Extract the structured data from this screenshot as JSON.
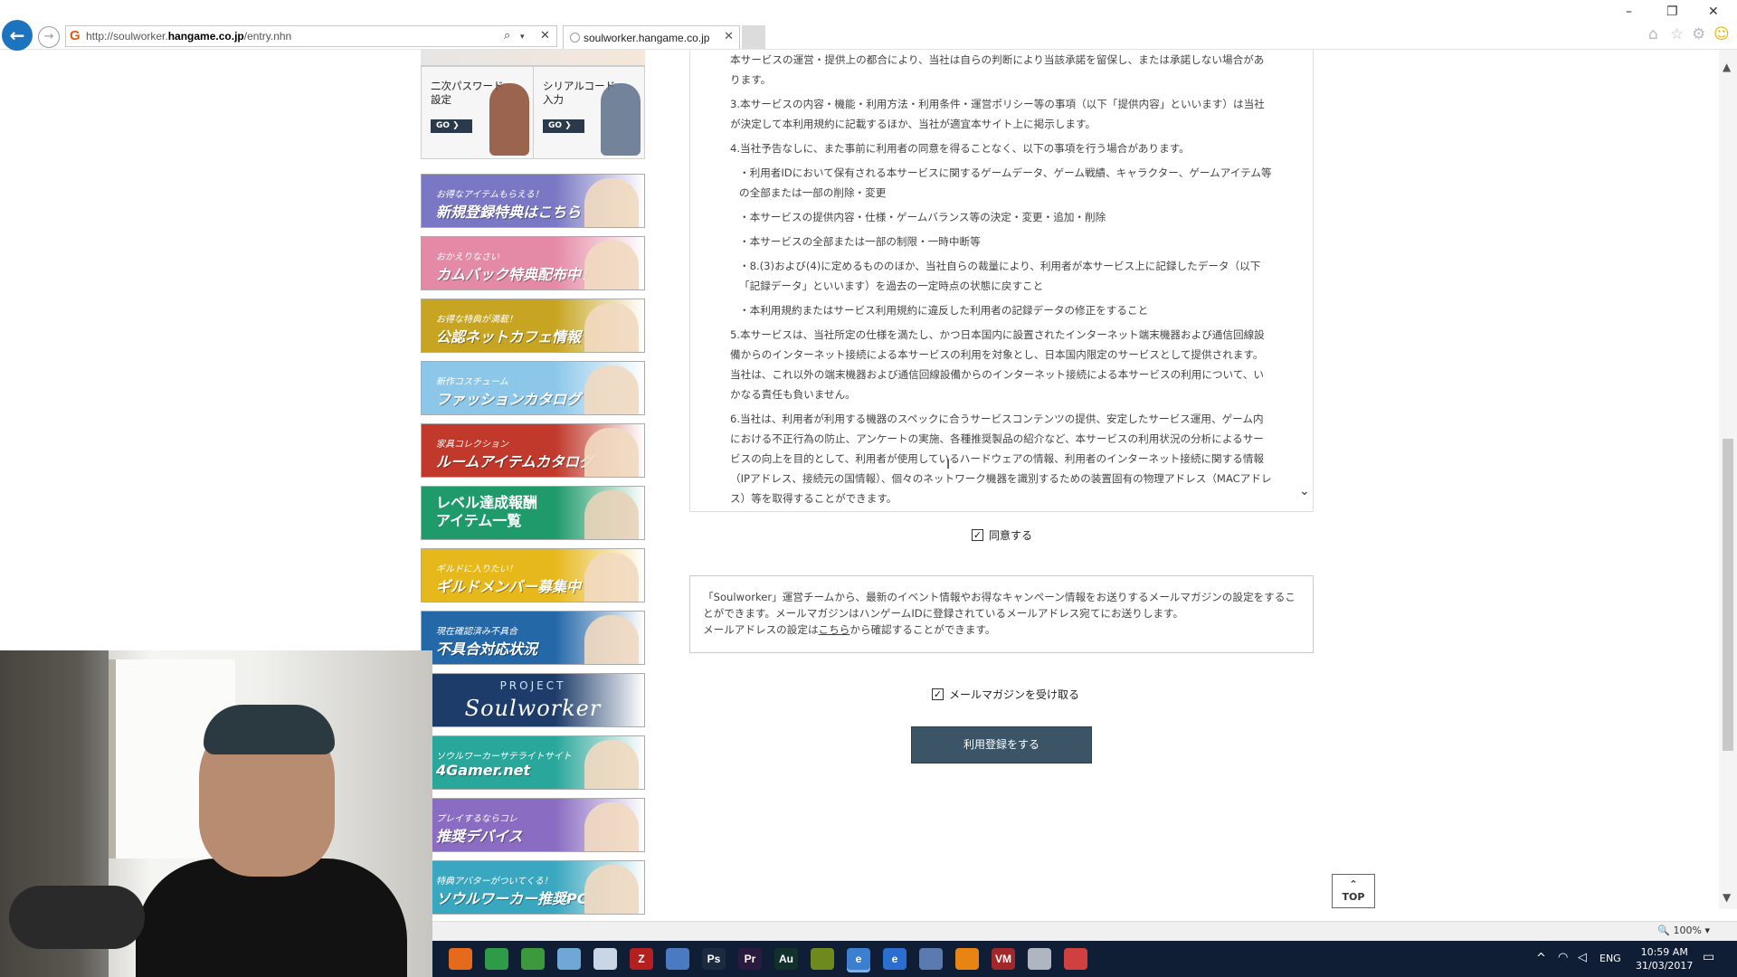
{
  "browser": {
    "url_prefix": "http://soulworker.",
    "url_domain": "hangame.co.jp",
    "url_path": "/entry.nhn",
    "tab_title": "soulworker.hangame.co.jp",
    "zoom": "100%"
  },
  "sidebar": {
    "shortcuts": [
      {
        "label": "二次パスワード\n設定",
        "go": "GO ❯",
        "color": "#8a4a30"
      },
      {
        "label": "シリアルコード\n入力",
        "go": "GO ❯",
        "color": "#5a6f8a"
      }
    ],
    "banners": [
      {
        "small": "お得なアイテムもらえる！",
        "big": "新規登録特典はこちら",
        "bg": "#7a78c4"
      },
      {
        "small": "おかえりなさい",
        "big": "カムバック特典配布中！",
        "bg": "#e58aa6"
      },
      {
        "small": "お得な特典が満載！",
        "big": "公認ネットカフェ情報",
        "bg": "#c7a522"
      },
      {
        "small": "新作コスチューム",
        "big": "ファッションカタログ",
        "bg": "#8cc7ea"
      },
      {
        "small": "家具コレクション",
        "big": "ルームアイテムカタログ",
        "bg": "#c0392b"
      },
      {
        "small": "",
        "big": "レベル達成報酬\nアイテム一覧",
        "bg": "#1f9a6a"
      },
      {
        "small": "ギルドに入りたい！",
        "big": "ギルドメンバー募集中",
        "bg": "#e7b81c"
      },
      {
        "small": "現在確認済み不具合",
        "big": "不具合対応状況",
        "bg": "#2468a8"
      },
      {
        "small": "PROJECT",
        "big": "Soulworker",
        "bg": "#1d3c6a"
      },
      {
        "small": "ソウルワーカーサテライトサイト",
        "big": "4Gamer.net",
        "bg": "#2aa79b"
      },
      {
        "small": "プレイするならコレ",
        "big": "推奨デバイス",
        "bg": "#8a6cc2"
      },
      {
        "small": "特典アバターがついてくる！",
        "big": "ソウルワーカー推奨PC",
        "bg": "#3aa7c0"
      }
    ]
  },
  "terms": {
    "paragraphs": [
      {
        "text": "本サービスの運営・提供上の都合により、当社は自らの判断により当該承諾を留保し、または承諾しない場合があります。",
        "sub": false
      },
      {
        "text": "3.本サービスの内容・機能・利用方法・利用条件・運営ポリシー等の事項（以下「提供内容」といいます）は当社が決定して本利用規約に記載するほか、当社が適宜本サイト上に掲示します。",
        "sub": false
      },
      {
        "text": "4.当社予告なしに、また事前に利用者の同意を得ることなく、以下の事項を行う場合があります。",
        "sub": false
      },
      {
        "text": "・利用者IDにおいて保有される本サービスに関するゲームデータ、ゲーム戦績、キャラクター、ゲームアイテム等の全部または一部の削除・変更",
        "sub": true
      },
      {
        "text": "・本サービスの提供内容・仕様・ゲームバランス等の決定・変更・追加・削除",
        "sub": true
      },
      {
        "text": "・本サービスの全部または一部の制限・一時中断等",
        "sub": true
      },
      {
        "text": "・8.(3)および(4)に定めるもののほか、当社自らの裁量により、利用者が本サービス上に記録したデータ（以下「記録データ」といいます）を過去の一定時点の状態に戻すこと",
        "sub": true
      },
      {
        "text": "・本利用規約またはサービス利用規約に違反した利用者の記録データの修正をすること",
        "sub": true
      },
      {
        "text": "5.本サービスは、当社所定の仕様を満たし、かつ日本国内に設置されたインターネット端末機器および通信回線設備からのインターネット接続による本サービスの利用を対象とし、日本国内限定のサービスとして提供されます。当社は、これ以外の端末機器および通信回線設備からのインターネット接続による本サービスの利用について、いかなる責任も負いません。",
        "sub": false
      },
      {
        "text": "6.当社は、利用者が利用する機器のスペックに合うサービスコンテンツの提供、安定したサービス運用、ゲーム内における不正行為の防止、アンケートの実施、各種推奨製品の紹介など、本サービスの利用状況の分析によるサービスの向上を目的として、利用者が使用しているハードウェアの情報、利用者のインターネット接続に関する情報（IPアドレス、接続元の国情報）、個々のネットワーク機器を識別するための装置固有の物理アドレス（MACアドレス）等を取得することができます。",
        "sub": false
      }
    ],
    "agree_label": "同意する",
    "agree_checked": "✓"
  },
  "newsletter": {
    "line1": "「Soulworker」運営チームから、最新のイベント情報やお得なキャンペーン情報をお送りするメールマガジンの設定をすることができます。メールマガジンはハンゲームIDに登録されているメールアドレス宛てにお送りします。",
    "line2_pre": "メールアドレスの設定は",
    "line2_link": "こちら",
    "line2_post": "から確認することができます。",
    "receive_label": "メールマガジンを受け取る",
    "receive_checked": "✓"
  },
  "submit_label": "利用登録をする",
  "top_label": "TOP",
  "top_arrow": "⌃",
  "taskbar": {
    "icons": [
      {
        "name": "firefox",
        "text": "",
        "color": "#e66a1c"
      },
      {
        "name": "chrome",
        "text": "",
        "color": "#2f9b48"
      },
      {
        "name": "spreadsheet",
        "text": "",
        "color": "#3c9a3c"
      },
      {
        "name": "paint",
        "text": "",
        "color": "#6fa8d6"
      },
      {
        "name": "notepad",
        "text": "",
        "color": "#c9d6e6"
      },
      {
        "name": "filezilla",
        "text": "Z",
        "color": "#b42020"
      },
      {
        "name": "network",
        "text": "",
        "color": "#4a7ac0"
      },
      {
        "name": "photoshop",
        "text": "Ps",
        "color": "#1b2a3f"
      },
      {
        "name": "premiere",
        "text": "Pr",
        "color": "#2a1a3f"
      },
      {
        "name": "audition",
        "text": "Au",
        "color": "#12312b"
      },
      {
        "name": "tool",
        "text": "",
        "color": "#6f8a1c"
      },
      {
        "name": "ie",
        "text": "e",
        "color": "#3a7fd0"
      },
      {
        "name": "edge",
        "text": "e",
        "color": "#2a6fd0"
      },
      {
        "name": "remote",
        "text": "",
        "color": "#5a7ab0"
      },
      {
        "name": "vlc",
        "text": "",
        "color": "#e88414"
      },
      {
        "name": "voicemeeter",
        "text": "VM",
        "color": "#a0282a"
      },
      {
        "name": "printer",
        "text": "",
        "color": "#b0b6c0"
      },
      {
        "name": "app",
        "text": "",
        "color": "#d04040"
      }
    ],
    "lang": "ENG",
    "time": "10:59 AM",
    "date": "31/03/2017"
  }
}
